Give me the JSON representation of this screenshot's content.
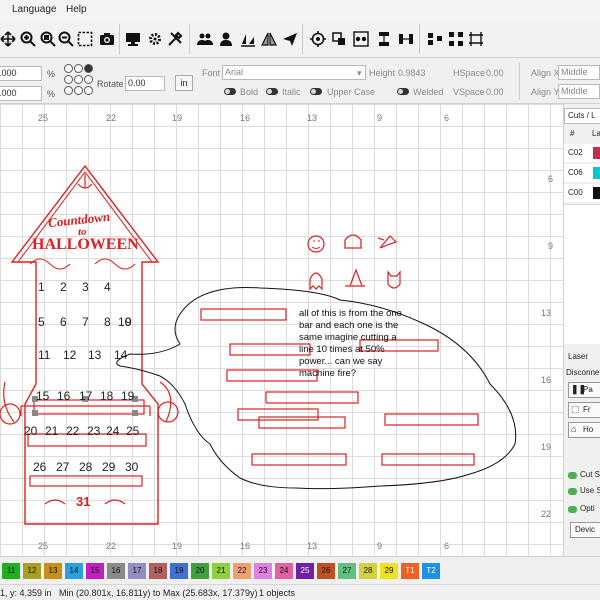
{
  "menu": {
    "language": "Language",
    "help": "Help"
  },
  "props": {
    "x_value": ".000",
    "y_value": ".000",
    "percent": "%",
    "rotate_label": "Rotate",
    "rotate_value": "0.00",
    "units_button": "in",
    "font_label": "Font",
    "font_value": "Arial",
    "height_label": "Height",
    "height_value": "0.9843",
    "hspace_label": "HSpace",
    "hspace_value": "0.00",
    "vspace_label": "VSpace",
    "vspace_value": "0.00",
    "alignx_label": "Align X",
    "alignx_value": "Middle",
    "aligny_label": "Align Y",
    "aligny_value": "Middle",
    "bold_label": "Bold",
    "italic_label": "Italic",
    "uppercase_label": "Upper Case",
    "welded_label": "Welded"
  },
  "ruler_top": [
    "25",
    "22",
    "19",
    "16",
    "13",
    "9",
    "6"
  ],
  "ruler_bottom": [
    "25",
    "22",
    "19",
    "16",
    "13",
    "9",
    "6"
  ],
  "ruler_right": [
    "6",
    "9",
    "13",
    "16",
    "19",
    "22"
  ],
  "artwork": {
    "countdown": "Countdown",
    "to": "to",
    "halloween": "HALLOWEEN",
    "numbers": [
      "1",
      "2",
      "3",
      "4",
      "5",
      "6",
      "7",
      "8",
      "9",
      "10",
      "11",
      "12",
      "13",
      "14",
      "15",
      "16",
      "17",
      "18",
      "19",
      "20",
      "21",
      "22",
      "23",
      "24",
      "25",
      "26",
      "27",
      "28",
      "29",
      "30",
      "31"
    ]
  },
  "annotation": "all of this is from the one bar and each one is the same imagine cutting a line 10 times at 50% power... can we say machine fire?",
  "right_panel": {
    "cuts_title": "Cuts / L",
    "col_hash": "#",
    "col_layer": "La",
    "layers": [
      {
        "name": "C02",
        "color": "#cc2a4a"
      },
      {
        "name": "C06",
        "color": "#00c8d0"
      },
      {
        "name": "C00",
        "color": "#111111"
      }
    ],
    "laser_title": "Laser",
    "disconnected": "Disconne",
    "btn_pause": "Pa",
    "btn_frame": "Fr",
    "btn_home": "Ho",
    "cut_selected": "Cut S",
    "use_selection": "Use S",
    "optimize": "Opti",
    "devices": "Devic"
  },
  "palette": [
    {
      "label": "11",
      "color": "#1fb01f"
    },
    {
      "label": "12",
      "color": "#a8a020"
    },
    {
      "label": "13",
      "color": "#c89018"
    },
    {
      "label": "14",
      "color": "#2aa0e0"
    },
    {
      "label": "15",
      "color": "#c020c0"
    },
    {
      "label": "16",
      "color": "#8a8a8a"
    },
    {
      "label": "17",
      "color": "#9090c0"
    },
    {
      "label": "18",
      "color": "#b06060"
    },
    {
      "label": "19",
      "color": "#4070d0"
    },
    {
      "label": "20",
      "color": "#40a040"
    },
    {
      "label": "21",
      "color": "#90d040"
    },
    {
      "label": "22",
      "color": "#f0a070"
    },
    {
      "label": "23",
      "color": "#e080e0"
    },
    {
      "label": "24",
      "color": "#e060a0"
    },
    {
      "label": "25",
      "color": "#7020a0"
    },
    {
      "label": "26",
      "color": "#c05020"
    },
    {
      "label": "27",
      "color": "#60c080"
    },
    {
      "label": "28",
      "color": "#d0d040"
    },
    {
      "label": "29",
      "color": "#f0e020"
    },
    {
      "label": "T1",
      "color": "#f06020"
    },
    {
      "label": "T2",
      "color": "#2090e0"
    }
  ],
  "status": {
    "coords": "1, y: 4.359 in",
    "bounds": "Min (20.801x, 16.811y) to Max (25.683x, 17.379y)",
    "objects": "1 objects"
  }
}
